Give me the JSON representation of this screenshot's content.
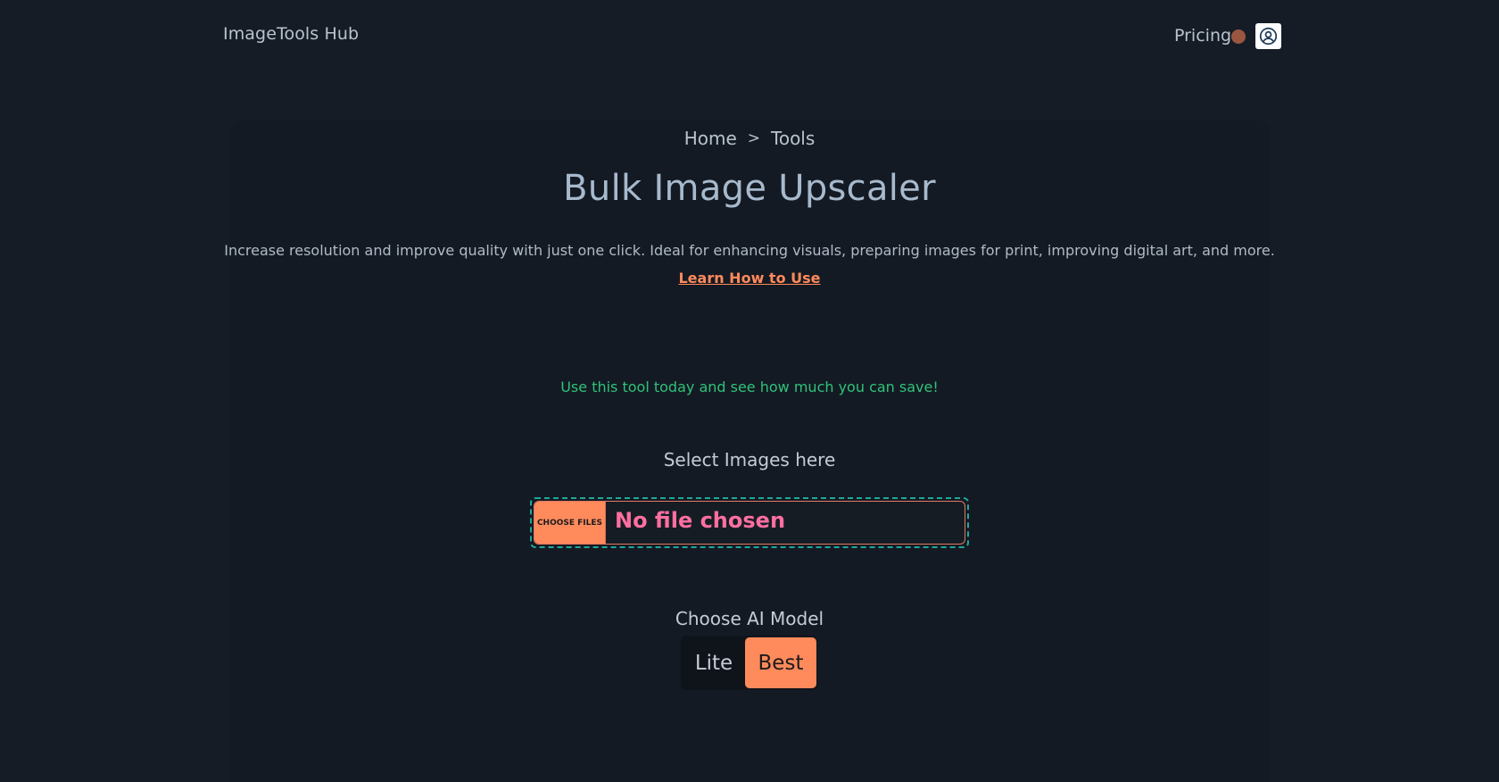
{
  "header": {
    "brand": "ImageTools Hub",
    "pricing_label": "Pricing"
  },
  "breadcrumb": {
    "items": [
      "Home",
      "Tools"
    ],
    "separator": ">"
  },
  "hero": {
    "title": "Bulk Image Upscaler",
    "description": "Increase resolution and improve quality with just one click. Ideal for enhancing visuals, preparing images for print, improving digital art, and more.",
    "learn_link": "Learn How to Use"
  },
  "promo": "Use this tool today and see how much you can save!",
  "upload": {
    "label": "Select Images here",
    "button_label": "CHOOSE FILES",
    "status": "No file chosen"
  },
  "model": {
    "label": "Choose AI Model",
    "options": [
      "Lite",
      "Best"
    ],
    "selected": "Best"
  },
  "colors": {
    "background": "#151c26",
    "accent": "#ff8a5c",
    "promo": "#2ec27a",
    "file_status": "#ff6fa0",
    "dropzone_border": "#1fa89a"
  },
  "icons": {
    "avatar": "user-circle-icon",
    "notification": "notification-dot-icon"
  }
}
